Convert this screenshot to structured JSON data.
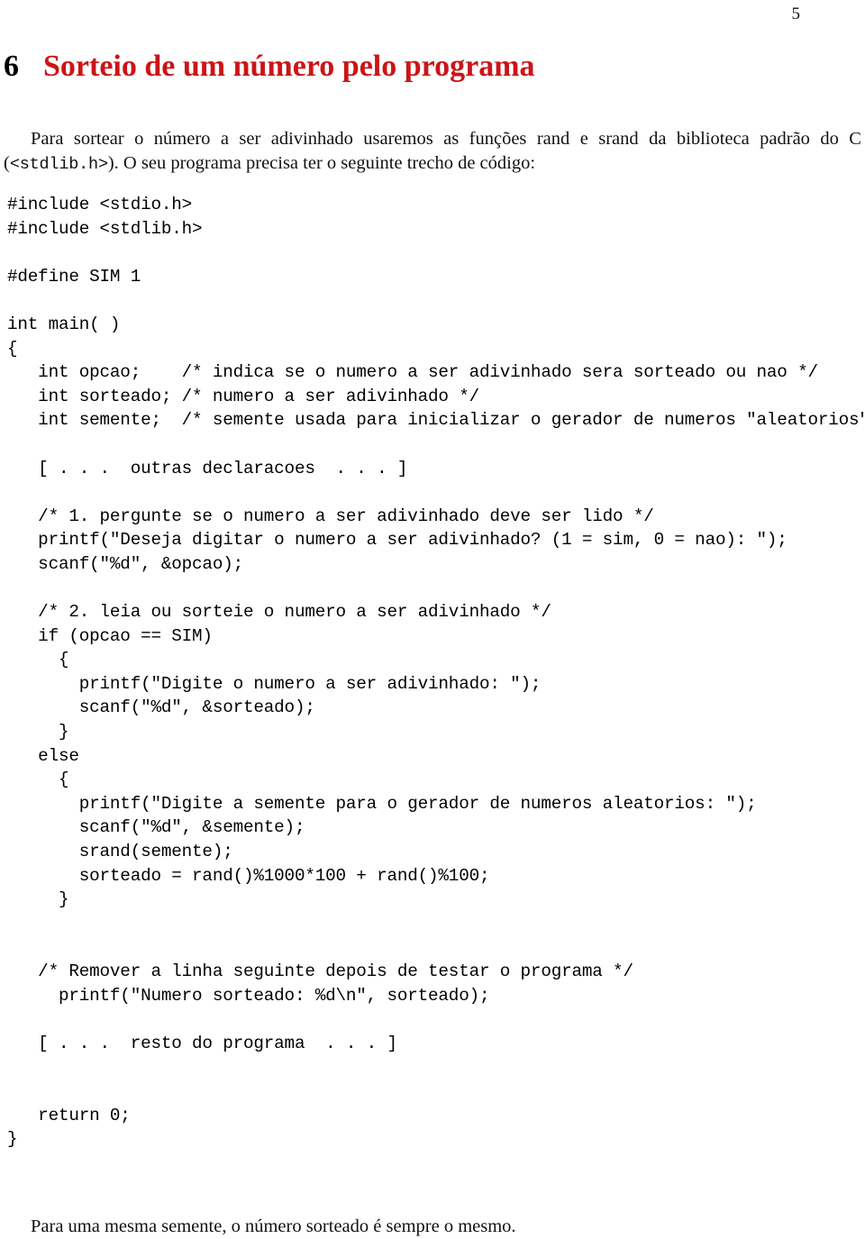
{
  "page": {
    "number": "5",
    "accent_color": "#cc1417",
    "text_color": "#111111",
    "background_color": "#ffffff"
  },
  "heading": {
    "number": "6",
    "title": "Sorteio de um número pelo programa"
  },
  "intro_paragraph": {
    "part1": "Para sortear o número a ser adivinhado usaremos as funções rand e srand da biblioteca padrão do C (",
    "code": "<stdlib.h>",
    "part2": "). O seu programa precisa ter o seguinte trecho de código:"
  },
  "code": {
    "language": "c",
    "lines": [
      "#include <stdio.h>",
      "#include <stdlib.h>",
      "",
      "#define SIM 1",
      "",
      "int main( )",
      "{",
      "   int opcao;    /* indica se o numero a ser adivinhado sera sorteado ou nao */",
      "   int sorteado; /* numero a ser adivinhado */",
      "   int semente;  /* semente usada para inicializar o gerador de numeros \"aleatorios\" */",
      "",
      "   [ . . .  outras declaracoes  . . . ]",
      "",
      "   /* 1. pergunte se o numero a ser adivinhado deve ser lido */",
      "   printf(\"Deseja digitar o numero a ser adivinhado? (1 = sim, 0 = nao): \");",
      "   scanf(\"%d\", &opcao);",
      "",
      "   /* 2. leia ou sorteie o numero a ser adivinhado */",
      "   if (opcao == SIM)",
      "     {",
      "       printf(\"Digite o numero a ser adivinhado: \");",
      "       scanf(\"%d\", &sorteado);",
      "     }",
      "   else",
      "     {",
      "       printf(\"Digite a semente para o gerador de numeros aleatorios: \");",
      "       scanf(\"%d\", &semente);",
      "       srand(semente);",
      "       sorteado = rand()%1000*100 + rand()%100;",
      "     }",
      "",
      "",
      "   /* Remover a linha seguinte depois de testar o programa */",
      "     printf(\"Numero sorteado: %d\\n\", sorteado);",
      "",
      "   [ . . .  resto do programa  . . . ]",
      "",
      "",
      "   return 0;",
      "}"
    ]
  },
  "closing_paragraph": {
    "text": "Para uma mesma semente, o número sorteado é sempre o mesmo."
  }
}
